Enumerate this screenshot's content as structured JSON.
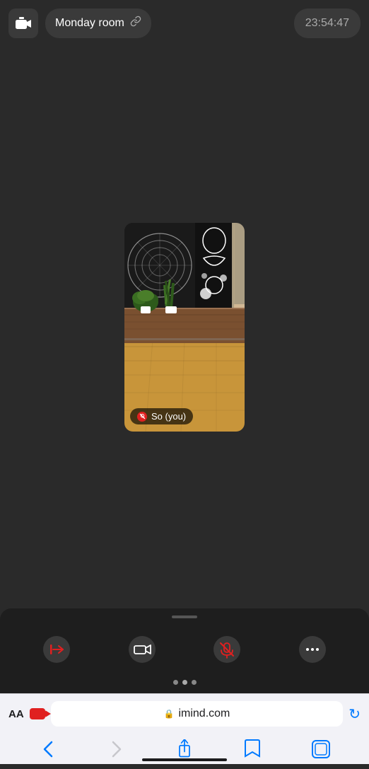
{
  "header": {
    "room_name": "Monday room",
    "time": "23:54:47",
    "camera_icon": "camera",
    "link_icon": "🔗"
  },
  "video": {
    "participant_name": "So  (you)",
    "muted": true
  },
  "controls": {
    "leave_label": "leave",
    "camera_label": "camera",
    "mute_label": "mute",
    "more_label": "more",
    "page_dots": [
      {
        "active": false
      },
      {
        "active": true
      },
      {
        "active": false
      }
    ]
  },
  "browser": {
    "aa_label": "AA",
    "url": "imind.com",
    "lock_icon": "lock"
  }
}
